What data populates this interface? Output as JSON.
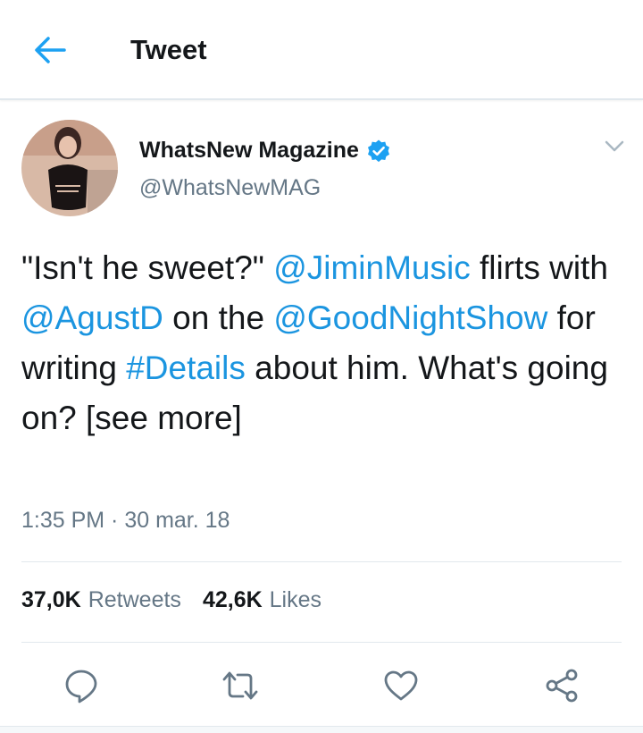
{
  "header": {
    "title": "Tweet",
    "back_icon": "arrow-left-icon",
    "accent": "#1da1f2"
  },
  "tweet": {
    "author": {
      "name": "WhatsNew Magazine",
      "handle": "@WhatsNewMAG",
      "verified": true,
      "avatar": "avatar"
    },
    "text_segments": [
      {
        "text": "\"Isn't he sweet?\" ",
        "type": "text"
      },
      {
        "text": "@JiminMusic",
        "type": "mention"
      },
      {
        "text": " flirts with ",
        "type": "text"
      },
      {
        "text": "@AgustD",
        "type": "mention"
      },
      {
        "text": " on the ",
        "type": "text"
      },
      {
        "text": "@GoodNightShow",
        "type": "mention"
      },
      {
        "text": " for writing ",
        "type": "text"
      },
      {
        "text": "#Details",
        "type": "hashtag"
      },
      {
        "text": " about him. What's going on? [see more]",
        "type": "text"
      }
    ],
    "timestamp": "1:35 PM · 30 mar. 18",
    "stats": {
      "retweets_count": "37,0K",
      "retweets_label": "Retweets",
      "likes_count": "42,6K",
      "likes_label": "Likes"
    },
    "actions": [
      "reply-icon",
      "retweet-icon",
      "like-icon",
      "share-icon"
    ],
    "colors": {
      "link": "#1b95e0",
      "verified": "#1da1f2",
      "secondary_text": "#657786",
      "primary_text": "#14171a"
    }
  }
}
